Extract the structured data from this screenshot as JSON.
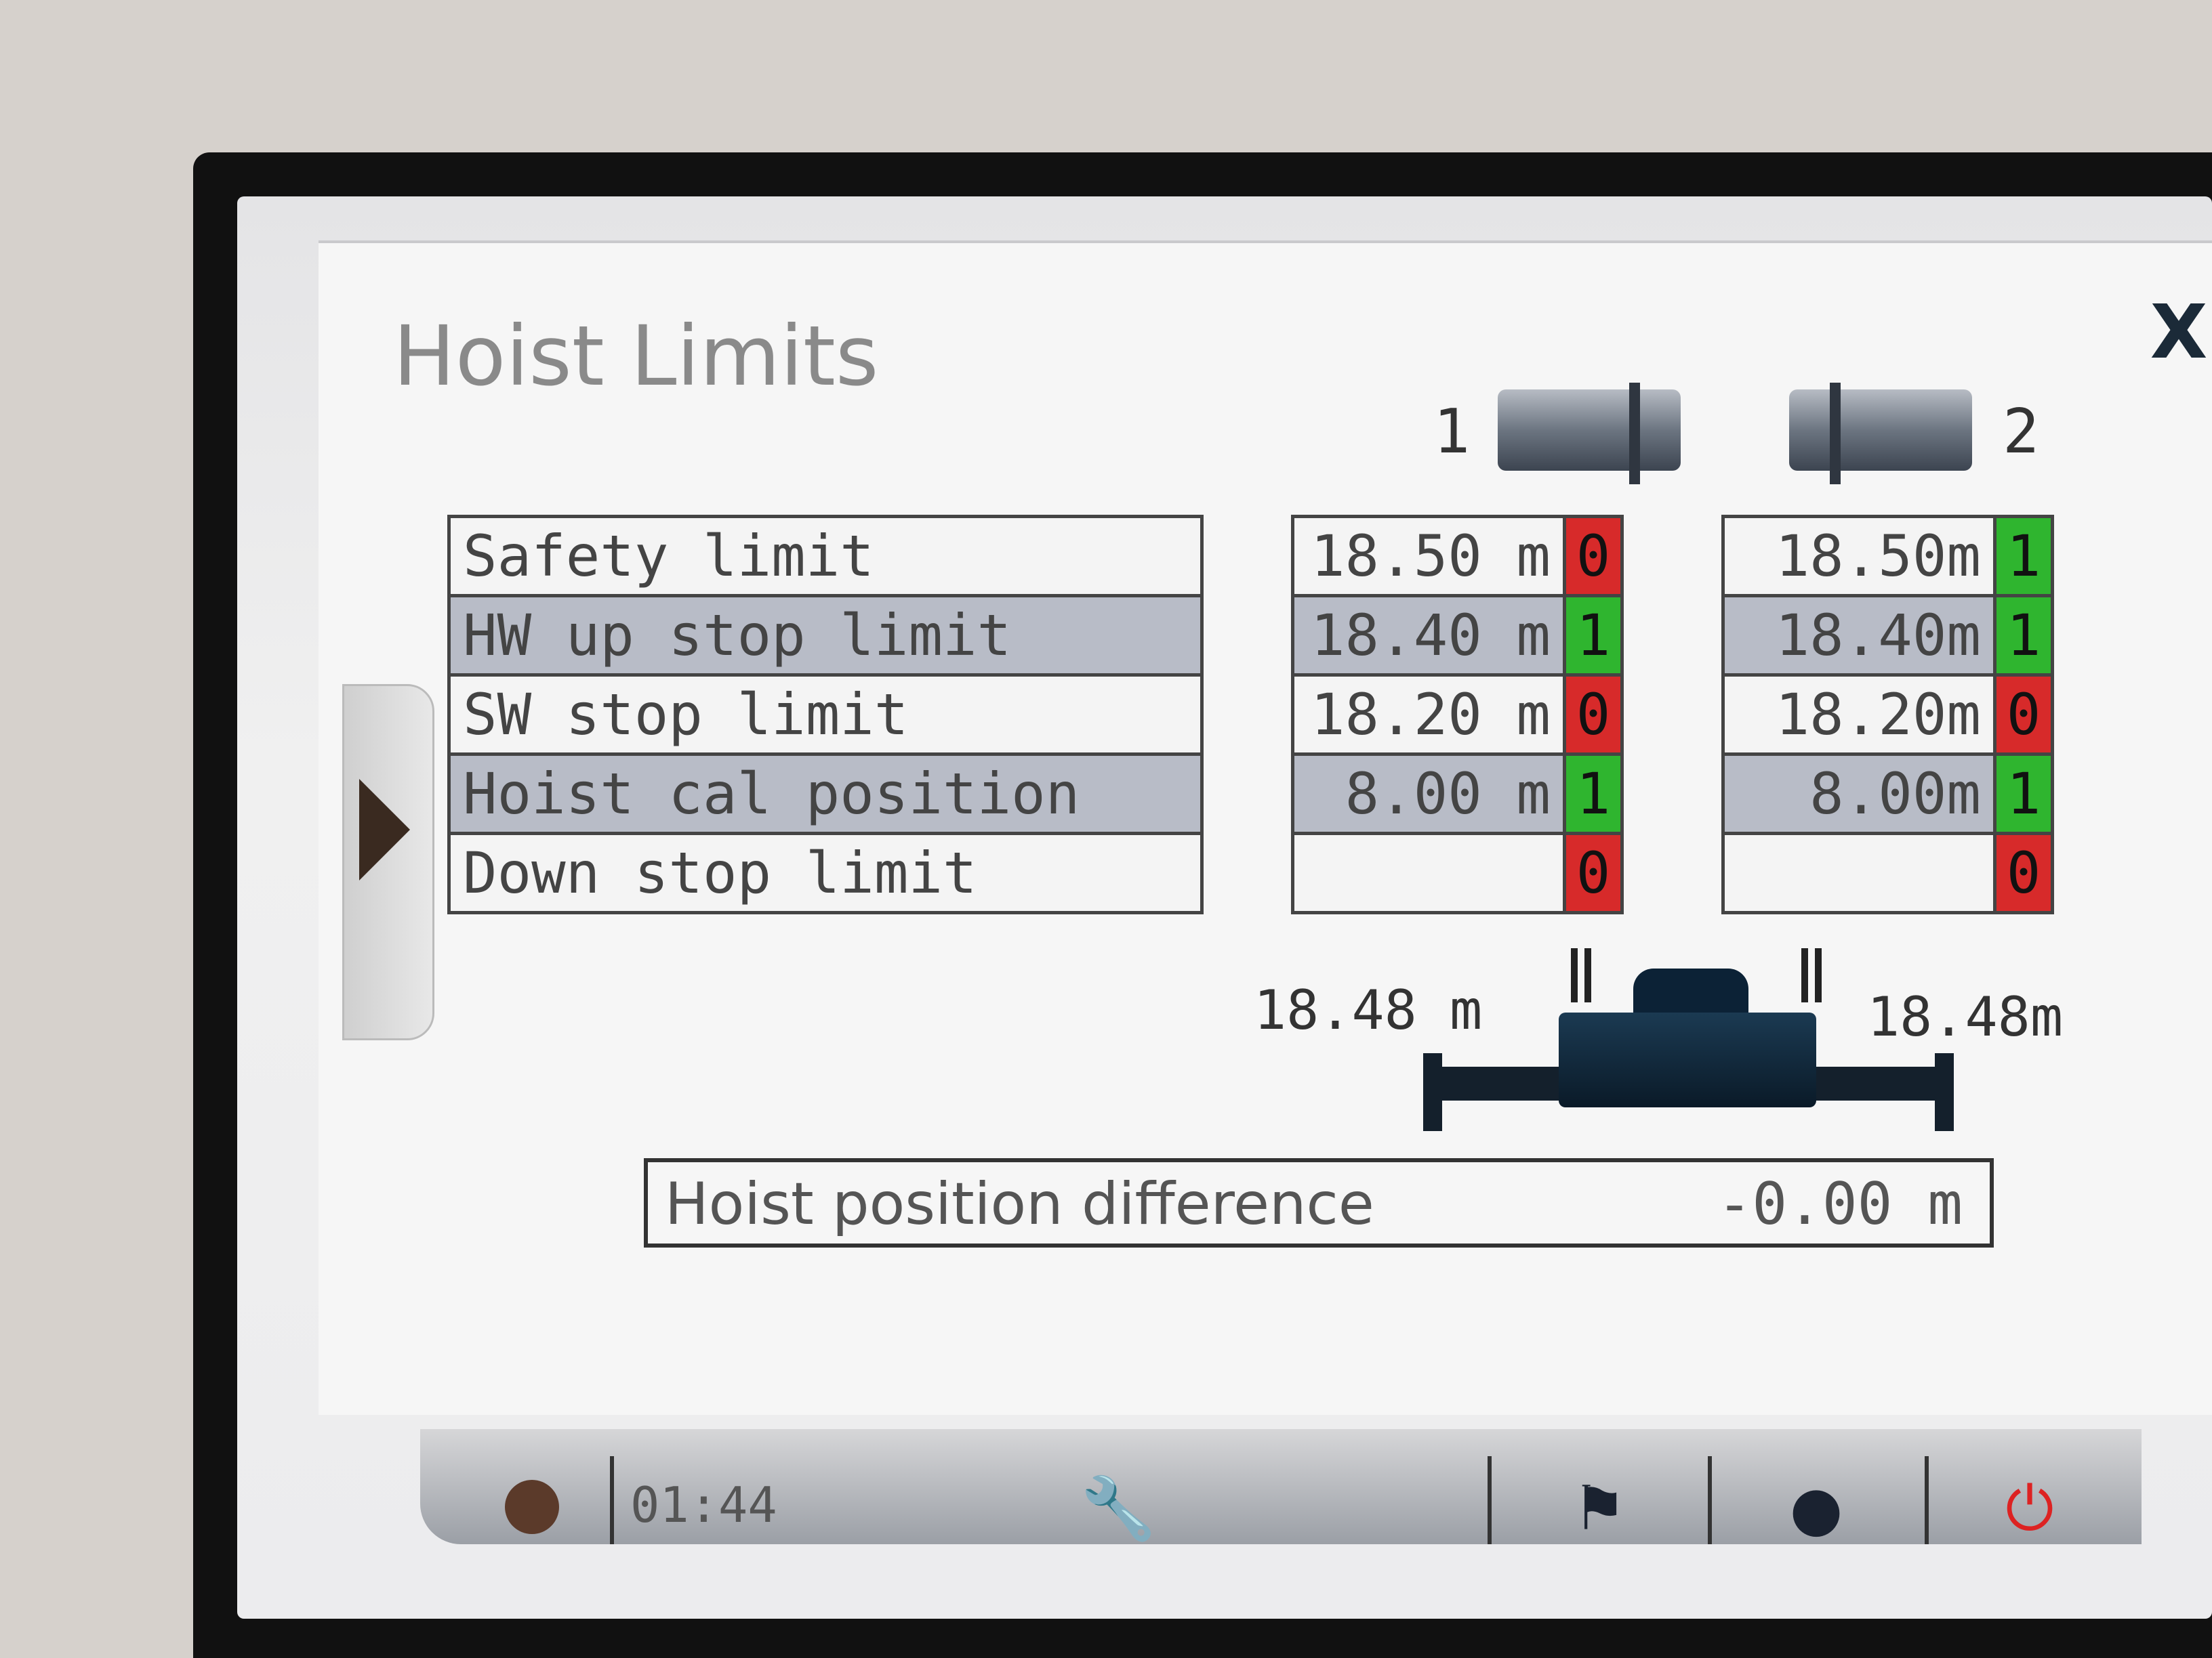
{
  "title": "Hoist Limits",
  "close_label": "X",
  "hoists": [
    {
      "label": "1",
      "limits": [
        {
          "value": "18.50 m",
          "state": "0",
          "active": false
        },
        {
          "value": "18.40 m",
          "state": "1",
          "active": true
        },
        {
          "value": "18.20 m",
          "state": "0",
          "active": false
        },
        {
          "value": "8.00 m",
          "state": "1",
          "active": true
        },
        {
          "value": "",
          "state": "0",
          "active": false
        }
      ],
      "position": "18.48 m"
    },
    {
      "label": "2",
      "limits": [
        {
          "value": "18.50m",
          "state": "1",
          "active": true
        },
        {
          "value": "18.40m",
          "state": "1",
          "active": true
        },
        {
          "value": "18.20m",
          "state": "0",
          "active": false
        },
        {
          "value": "8.00m",
          "state": "1",
          "active": true
        },
        {
          "value": "",
          "state": "0",
          "active": false
        }
      ],
      "position": "18.48m"
    }
  ],
  "limit_names": [
    "Safety limit",
    "HW up stop limit",
    "SW stop limit",
    "Hoist cal position",
    "Down stop limit"
  ],
  "difference": {
    "label": "Hoist position difference",
    "value": "-0.00 m"
  },
  "statusbar": {
    "time": "01:44",
    "icons": [
      "wrench-icon",
      "flag-icon",
      "user-icon",
      "power-icon"
    ]
  },
  "colors": {
    "on": "#2fb52f",
    "off": "#d72a2a",
    "row_alt": "#b8bcc7"
  }
}
